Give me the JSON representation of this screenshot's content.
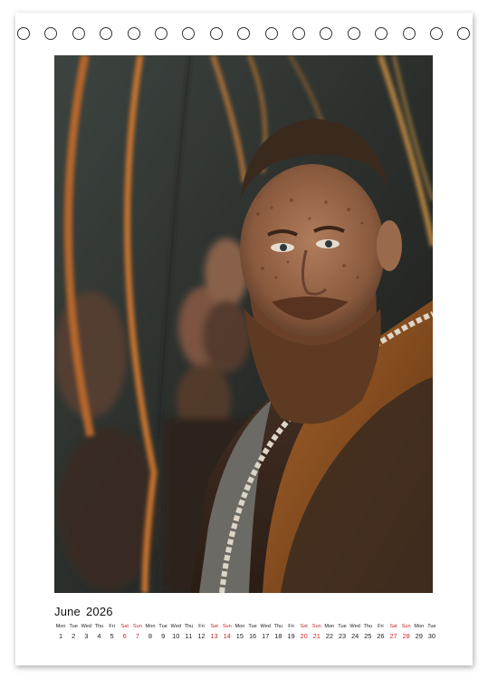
{
  "calendar": {
    "month": "June",
    "year": "2026",
    "days": [
      {
        "wd": "Mon",
        "n": "1",
        "we": false
      },
      {
        "wd": "Tue",
        "n": "2",
        "we": false
      },
      {
        "wd": "Wed",
        "n": "3",
        "we": false
      },
      {
        "wd": "Thu",
        "n": "4",
        "we": false
      },
      {
        "wd": "Fri",
        "n": "5",
        "we": false
      },
      {
        "wd": "Sat",
        "n": "6",
        "we": true
      },
      {
        "wd": "Sun",
        "n": "7",
        "we": true
      },
      {
        "wd": "Mon",
        "n": "8",
        "we": false
      },
      {
        "wd": "Tue",
        "n": "9",
        "we": false
      },
      {
        "wd": "Wed",
        "n": "10",
        "we": false
      },
      {
        "wd": "Thu",
        "n": "11",
        "we": false
      },
      {
        "wd": "Fri",
        "n": "12",
        "we": false
      },
      {
        "wd": "Sat",
        "n": "13",
        "we": true
      },
      {
        "wd": "Sun",
        "n": "14",
        "we": true
      },
      {
        "wd": "Mon",
        "n": "15",
        "we": false
      },
      {
        "wd": "Tue",
        "n": "16",
        "we": false
      },
      {
        "wd": "Wed",
        "n": "17",
        "we": false
      },
      {
        "wd": "Thu",
        "n": "18",
        "we": false
      },
      {
        "wd": "Fri",
        "n": "19",
        "we": false
      },
      {
        "wd": "Sat",
        "n": "20",
        "we": true
      },
      {
        "wd": "Sun",
        "n": "21",
        "we": true
      },
      {
        "wd": "Mon",
        "n": "22",
        "we": false
      },
      {
        "wd": "Tue",
        "n": "23",
        "we": false
      },
      {
        "wd": "Wed",
        "n": "24",
        "we": false
      },
      {
        "wd": "Thu",
        "n": "25",
        "we": false
      },
      {
        "wd": "Fri",
        "n": "26",
        "we": false
      },
      {
        "wd": "Sat",
        "n": "27",
        "we": true
      },
      {
        "wd": "Sun",
        "n": "28",
        "we": true
      },
      {
        "wd": "Mon",
        "n": "29",
        "we": false
      },
      {
        "wd": "Tue",
        "n": "30",
        "we": false
      }
    ],
    "weekend_color": "#c62828"
  },
  "binding": {
    "ring_count": 17
  }
}
